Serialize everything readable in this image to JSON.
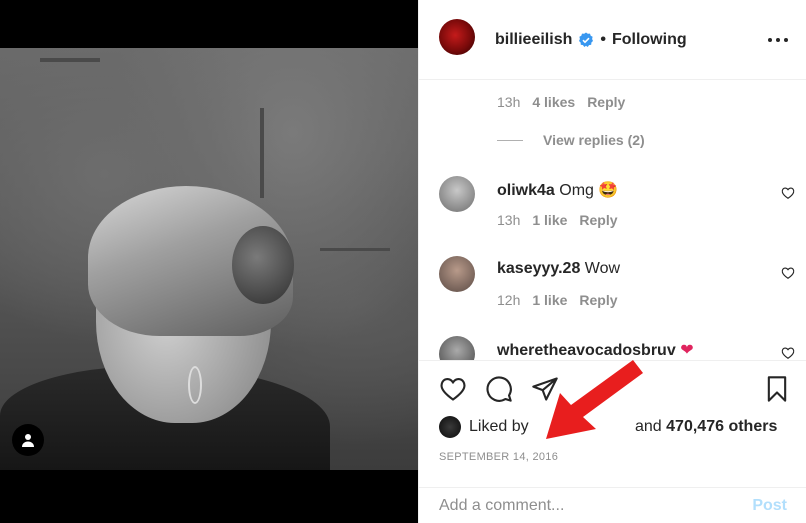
{
  "header": {
    "username": "billieeilish",
    "separator": "•",
    "following_label": "Following",
    "verified_icon": "verified-badge-icon",
    "more_icon": "more-options-icon"
  },
  "thread": {
    "prev_reply_meta": {
      "time": "13h",
      "likes": "4 likes",
      "reply": "Reply"
    },
    "view_replies": "View replies (2)"
  },
  "comments": [
    {
      "user": "oliwk4a",
      "text": "Omg",
      "emoji": "🤩",
      "time": "13h",
      "likes": "1 like",
      "reply": "Reply"
    },
    {
      "user": "kaseyyy.28",
      "text": "Wow",
      "emoji": "",
      "time": "12h",
      "likes": "1 like",
      "reply": "Reply"
    },
    {
      "user": "wheretheavocadosbruv",
      "text": "",
      "emoji": "❤",
      "time": "",
      "likes": "",
      "reply": ""
    }
  ],
  "actions": {
    "like_icon": "heart-icon",
    "comment_icon": "comment-bubble-icon",
    "share_icon": "paper-plane-icon",
    "save_icon": "bookmark-icon"
  },
  "likes": {
    "liked_by": "Liked by",
    "and_text": "and",
    "others": "470,476 others"
  },
  "date": "SEPTEMBER 14, 2016",
  "add_comment": {
    "placeholder": "Add a comment...",
    "post_label": "Post"
  },
  "colors": {
    "annotation_arrow": "#e81e1e",
    "post_disabled": "#b2dffc",
    "verified": "#3897f0"
  }
}
